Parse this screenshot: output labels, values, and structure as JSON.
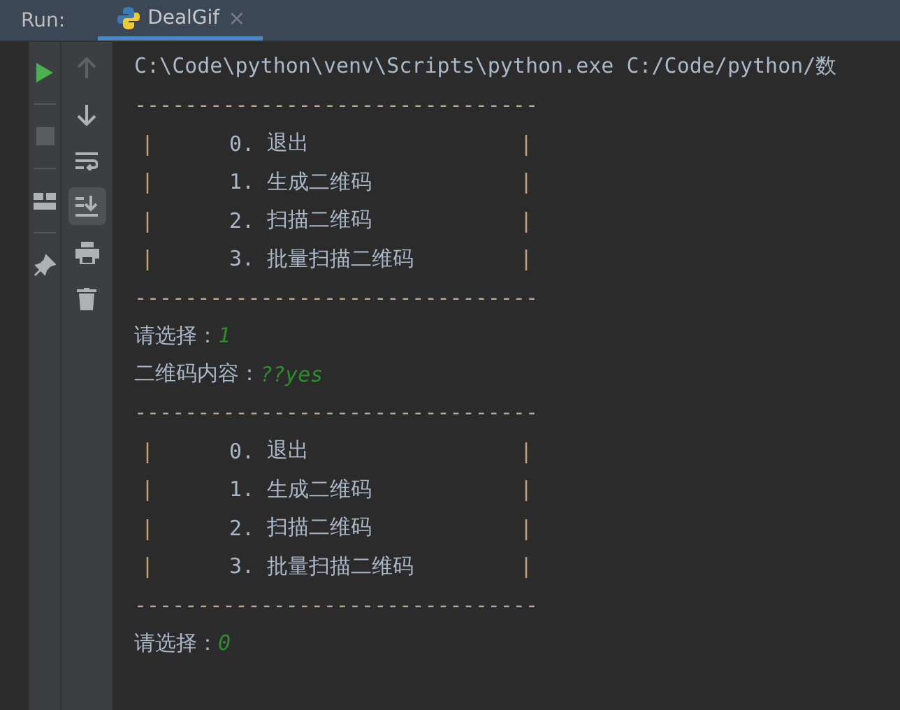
{
  "header": {
    "label": "Run:",
    "tabs": [
      {
        "label": "DealGif",
        "close": "×",
        "selected": true
      }
    ]
  },
  "run_tools": [
    {
      "disabled": false
    },
    {
      "disabled": true
    },
    {
      "disabled": false
    },
    {
      "disabled": false
    }
  ],
  "console_tools": [
    {
      "disabled": true,
      "selected": false
    },
    {
      "disabled": false,
      "selected": false
    },
    {
      "disabled": false,
      "selected": false
    },
    {
      "disabled": false,
      "selected": true
    },
    {
      "disabled": false,
      "selected": false
    },
    {
      "disabled": false,
      "selected": false
    }
  ],
  "console": [
    {
      "kind": "command",
      "text": "C:\\Code\\python\\venv\\Scripts\\python.exe C:/Code/python/数"
    },
    {
      "kind": "rule",
      "text": "--------------------------------"
    },
    {
      "kind": "menu",
      "left": "|",
      "number": "0.",
      "label": "退出",
      "right": "|"
    },
    {
      "kind": "menu",
      "left": "|",
      "number": "1.",
      "label": "生成二维码",
      "right": "|"
    },
    {
      "kind": "menu",
      "left": "|",
      "number": "2.",
      "label": "扫描二维码",
      "right": "|"
    },
    {
      "kind": "menu",
      "left": "|",
      "number": "3.",
      "label": "批量扫描二维码",
      "right": "|"
    },
    {
      "kind": "rule",
      "text": "--------------------------------"
    },
    {
      "kind": "prompt",
      "label": "请选择：",
      "input": "1"
    },
    {
      "kind": "prompt",
      "label": "二维码内容：",
      "input": "??yes"
    },
    {
      "kind": "rule",
      "text": "--------------------------------"
    },
    {
      "kind": "menu",
      "left": "|",
      "number": "0.",
      "label": "退出",
      "right": "|"
    },
    {
      "kind": "menu",
      "left": "|",
      "number": "1.",
      "label": "生成二维码",
      "right": "|"
    },
    {
      "kind": "menu",
      "left": "|",
      "number": "2.",
      "label": "扫描二维码",
      "right": "|"
    },
    {
      "kind": "menu",
      "left": "|",
      "number": "3.",
      "label": "批量扫描二维码",
      "right": "|"
    },
    {
      "kind": "rule",
      "text": "--------------------------------"
    },
    {
      "kind": "prompt",
      "label": "请选择：",
      "input": "0"
    }
  ]
}
